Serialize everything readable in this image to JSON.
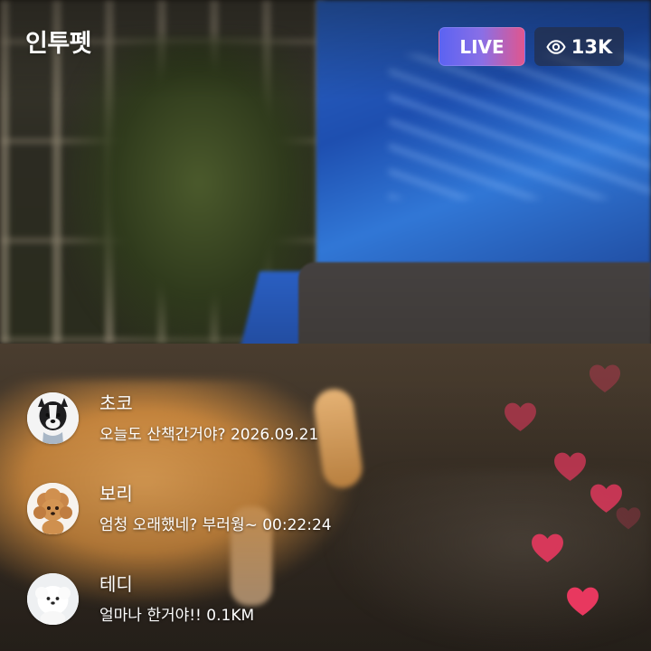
{
  "app": {
    "brand": "인투펫"
  },
  "header": {
    "live_label": "LIVE",
    "viewer_count": "13K",
    "viewer_icon": "eye-icon",
    "live_gradient": [
      "#5b63f2",
      "#e0568e"
    ]
  },
  "comments": [
    {
      "name": "초코",
      "text": "오늘도 산책간거야? 2026.09.21",
      "avatar": "border-collie-avatar"
    },
    {
      "name": "보리",
      "text": "엄청 오래했네? 부러웡~ 00:22:24",
      "avatar": "poodle-avatar"
    },
    {
      "name": "테디",
      "text": "얼마나 한거야!! 0.1KM",
      "avatar": "white-fluffy-dog-avatar"
    }
  ],
  "reactions": {
    "icon": "heart-icon",
    "color": "#e8385f",
    "count": 7
  }
}
